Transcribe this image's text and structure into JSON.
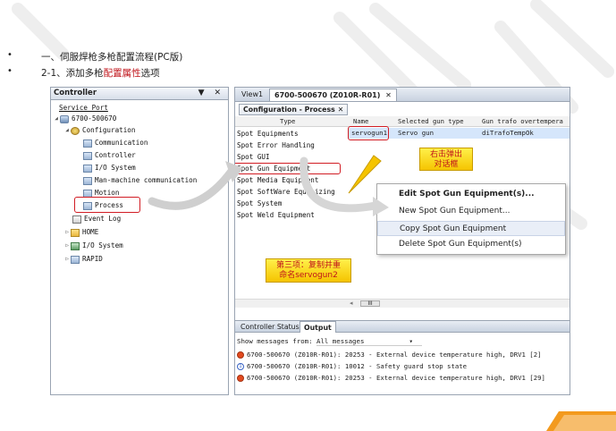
{
  "bullets": [
    {
      "dot": "•",
      "text_prefix": "一、伺服焊枪多枪配置流程(PC版)",
      "text_red": "",
      "text_suffix": ""
    },
    {
      "dot": "•",
      "text_prefix": "2-1、添加多枪",
      "text_red": "配置属性",
      "text_suffix": "选项"
    }
  ],
  "left_panel": {
    "title": "Controller",
    "controls": "▼ ✕",
    "tree": [
      {
        "label": "Service Port",
        "icon": "",
        "twisty": "",
        "indent": 0
      },
      {
        "label": "6700-500670",
        "icon": "robot-icon",
        "twisty": "◢",
        "indent": 0
      },
      {
        "label": "Configuration",
        "icon": "gear-icon",
        "twisty": "◢",
        "indent": 1
      },
      {
        "label": "Communication",
        "icon": "config-icon",
        "twisty": "",
        "indent": 2
      },
      {
        "label": "Controller",
        "icon": "config-icon",
        "twisty": "",
        "indent": 2
      },
      {
        "label": "I/O System",
        "icon": "config-icon",
        "twisty": "",
        "indent": 2
      },
      {
        "label": "Man-machine communication",
        "icon": "config-icon",
        "twisty": "",
        "indent": 2
      },
      {
        "label": "Motion",
        "icon": "config-icon",
        "twisty": "",
        "indent": 2
      },
      {
        "label": "Process",
        "icon": "config-icon",
        "twisty": "",
        "indent": 2
      },
      {
        "label": "Event Log",
        "icon": "event-log-icon",
        "twisty": "",
        "indent": 1
      },
      {
        "label": "HOME",
        "icon": "folder-icon",
        "twisty": "▷",
        "indent": 1
      },
      {
        "label": "I/O System",
        "icon": "io-icon",
        "twisty": "▷",
        "indent": 1
      },
      {
        "label": "RAPID",
        "icon": "rapid-icon",
        "twisty": "▷",
        "indent": 1
      }
    ]
  },
  "right_panel": {
    "doc_tabs": [
      "View1",
      "6700-500670 (Z010R-R01)",
      "✕"
    ],
    "sub_tab": "Configuration - Process",
    "sub_tab_close": "✕",
    "columns": [
      "Type",
      "Name",
      "Selected gun type",
      "Gun trafo overtempera"
    ],
    "types": [
      "Spot Equipments",
      "Spot Error Handling",
      "Spot GUI",
      "Spot Gun Equipment",
      "Spot Media Equipment",
      "Spot SoftWare Equalizing",
      "Spot System",
      "Spot Weld Equipment"
    ],
    "row": {
      "name": "servogun1",
      "gun_type": "Servo gun",
      "trafo": "diTrafoTempOk"
    },
    "callout_top": {
      "line1": "右击弹出",
      "line2": "对话框"
    },
    "callout_bottom": {
      "line1": "第三项：复制并重",
      "line2": "命名servogun2"
    },
    "context_menu": [
      "Edit Spot Gun Equipment(s)...",
      "New Spot Gun Equipment...",
      "Copy Spot Gun Equipment",
      "Delete Spot Gun Equipment(s)"
    ],
    "scroll_thumb": "III",
    "output_tabs": [
      "Controller Status",
      "Output"
    ],
    "filter_label": "Show messages from:",
    "filter_value": "All messages",
    "filter_arrow": "▾",
    "messages": [
      {
        "icon": "warning-icon",
        "text": "6700-500670 (Z010R-R01): 20253 - External device temperature high, DRV1 [2]"
      },
      {
        "icon": "info-icon",
        "text": "6700-500670 (Z010R-R01): 10012 - Safety guard stop state"
      },
      {
        "icon": "warning-icon",
        "text": "6700-500670 (Z010R-R01): 20253 - External device temperature high, DRV1 [29]"
      }
    ]
  },
  "colors": {
    "accent_red": "#c0141b",
    "callout_yellow": "#f5c400",
    "selection": "#d5e6fb",
    "deco_orange": "#f39a1e"
  }
}
